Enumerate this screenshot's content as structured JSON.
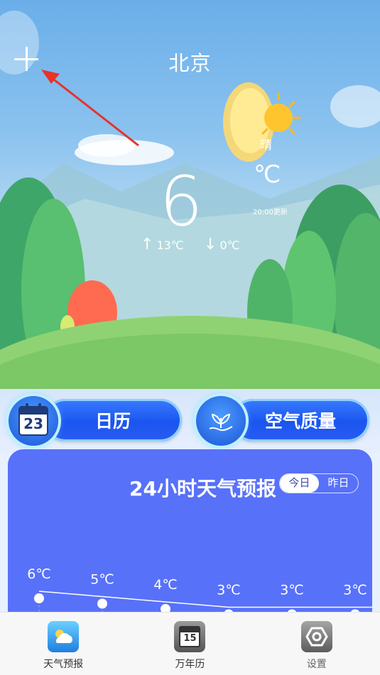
{
  "header": {
    "city": "北京",
    "add_icon": "plus-icon"
  },
  "current": {
    "temperature": "6",
    "unit": "℃",
    "condition": "晴",
    "updated": "20:00更新",
    "high": "13℃",
    "low": "0℃"
  },
  "actions": {
    "calendar": {
      "label": "日历",
      "icon_number": "23",
      "icon": "calendar-icon"
    },
    "air_quality": {
      "label": "空气质量",
      "icon": "plant-hand-icon"
    }
  },
  "forecast": {
    "title": "24小时天气预报",
    "tabs": [
      {
        "label": "今日",
        "active": true
      },
      {
        "label": "昨日",
        "active": false
      }
    ],
    "temps": [
      "6℃",
      "5℃",
      "4℃",
      "3℃",
      "3℃",
      "3℃"
    ],
    "values": [
      6,
      5,
      4,
      3,
      3,
      3
    ]
  },
  "nav": {
    "items": [
      {
        "label": "天气预报",
        "icon": "weather-icon"
      },
      {
        "label": "万年历",
        "icon": "almanac-icon",
        "icon_number": "15"
      },
      {
        "label": "设置",
        "icon": "settings-icon"
      }
    ]
  }
}
